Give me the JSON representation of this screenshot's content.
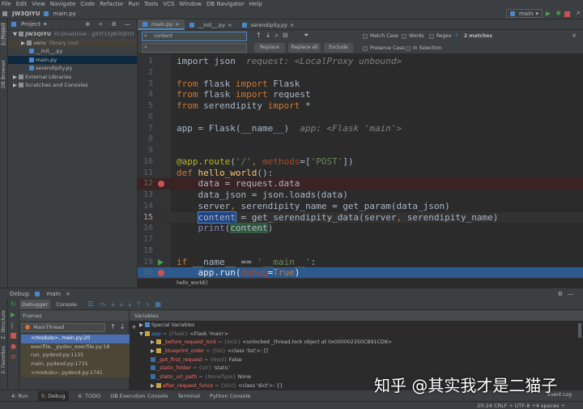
{
  "menu": [
    "File",
    "Edit",
    "View",
    "Navigate",
    "Code",
    "Refactor",
    "Run",
    "Tools",
    "VCS",
    "Window",
    "DB Navigator",
    "Help"
  ],
  "breadcrumb": {
    "project": "JW3QIYU",
    "file": "main.py"
  },
  "run_config": "main",
  "left_strip": {
    "project": "1: Project",
    "db": "DB Browser",
    "structure": "Z: Structure",
    "favorites": "2: Favorites"
  },
  "project_panel": {
    "title": "Project",
    "tree": [
      {
        "label": "JW3QIYU",
        "extra": "H:\\OneDrive - JJXY(1)\\JW3QIYU",
        "level": 0,
        "type": "folder"
      },
      {
        "label": "venv",
        "extra": "library root",
        "level": 1,
        "type": "folder"
      },
      {
        "label": "__init__.py",
        "extra": "",
        "level": 2,
        "type": "py"
      },
      {
        "label": "main.py",
        "extra": "",
        "level": 2,
        "type": "py"
      },
      {
        "label": "serendipity.py",
        "extra": "",
        "level": 2,
        "type": "py"
      },
      {
        "label": "External Libraries",
        "extra": "",
        "level": 0,
        "type": "folder"
      },
      {
        "label": "Scratches and Consoles",
        "extra": "",
        "level": 0,
        "type": "folder"
      }
    ]
  },
  "editor_tabs": [
    {
      "label": "main.py",
      "active": true
    },
    {
      "label": "__init__.py",
      "active": false
    },
    {
      "label": "serendipity.py",
      "active": false
    }
  ],
  "search": {
    "find_value": "content",
    "replace_value": "",
    "replace_label": "Replace",
    "replace_all_label": "Replace all",
    "exclude_label": "Exclude",
    "match_case": "Match Case",
    "words": "Words",
    "regex": "Regex",
    "regex_help": "?",
    "matches": "2 matches",
    "preserve_case": "Preserve Case",
    "in_selection": "In Selection"
  },
  "code_lines": [
    {
      "n": "1",
      "tokens": [
        [
          "import json",
          "t"
        ],
        [
          "  request: <LocalProxy unbound>",
          "c"
        ]
      ]
    },
    {
      "n": "2",
      "tokens": []
    },
    {
      "n": "3",
      "tokens": [
        [
          "from ",
          "k"
        ],
        [
          "flask ",
          "t"
        ],
        [
          "import ",
          "k"
        ],
        [
          "Flask",
          "t"
        ]
      ]
    },
    {
      "n": "4",
      "tokens": [
        [
          "from ",
          "k"
        ],
        [
          "flask ",
          "t"
        ],
        [
          "import ",
          "k"
        ],
        [
          "request",
          "t"
        ]
      ]
    },
    {
      "n": "5",
      "tokens": [
        [
          "from ",
          "k"
        ],
        [
          "serendipity ",
          "t"
        ],
        [
          "import ",
          "k"
        ],
        [
          "*",
          "t"
        ]
      ]
    },
    {
      "n": "6",
      "tokens": []
    },
    {
      "n": "7",
      "tokens": [
        [
          "app = Flask(__name__)",
          "t"
        ],
        [
          "  app: <Flask 'main'>",
          "c"
        ]
      ]
    },
    {
      "n": "8",
      "tokens": []
    },
    {
      "n": "9",
      "tokens": []
    },
    {
      "n": "10",
      "tokens": [
        [
          "@app.route",
          "d"
        ],
        [
          "(",
          "t"
        ],
        [
          "'/'",
          "s"
        ],
        [
          ", ",
          "k"
        ],
        [
          "methods",
          "p"
        ],
        [
          "=[",
          "t"
        ],
        [
          "'POST'",
          "s"
        ],
        [
          "])",
          "t"
        ]
      ]
    },
    {
      "n": "11",
      "tokens": [
        [
          "def ",
          "k"
        ],
        [
          "hello_world",
          "f"
        ],
        [
          "():",
          "t"
        ]
      ]
    },
    {
      "n": "12",
      "tokens": [
        [
          "    data = request.data",
          "t"
        ]
      ],
      "bp": true
    },
    {
      "n": "13",
      "tokens": [
        [
          "    data_json = json.loads(data)",
          "t"
        ]
      ]
    },
    {
      "n": "14",
      "tokens": [
        [
          "    server",
          "t"
        ],
        [
          ", ",
          "k"
        ],
        [
          "serendipity_name = get_param(data_json)",
          "t"
        ]
      ]
    },
    {
      "n": "15",
      "tokens": [
        [
          "    ",
          "t"
        ],
        [
          "content",
          "hl1"
        ],
        [
          " = get_serendipity_data(server",
          "t"
        ],
        [
          ", ",
          "k"
        ],
        [
          "serendipity_name)",
          "t"
        ]
      ]
    },
    {
      "n": "16",
      "tokens": [
        [
          "    ",
          "t"
        ],
        [
          "print",
          "b"
        ],
        [
          "(",
          "t"
        ],
        [
          "content",
          "hl2"
        ],
        [
          ")",
          "t"
        ]
      ]
    },
    {
      "n": "17",
      "tokens": []
    },
    {
      "n": "18",
      "tokens": []
    },
    {
      "n": "19",
      "tokens": [
        [
          "if ",
          "k"
        ],
        [
          "__name__ == ",
          "t"
        ],
        [
          "'__main__'",
          "s"
        ],
        [
          ":",
          "t"
        ]
      ],
      "run": true
    },
    {
      "n": "20",
      "tokens": [
        [
          "    app.run(",
          "t"
        ],
        [
          "debug",
          "p"
        ],
        [
          "=",
          "t"
        ],
        [
          "True",
          "k"
        ],
        [
          ")",
          "t"
        ]
      ],
      "bp": true,
      "exec": true
    }
  ],
  "editor_breadcrumb": "hello_world()",
  "debug": {
    "label": "Debug:",
    "session": "main",
    "tabs": [
      "Debugger",
      "Console"
    ],
    "frames_title": "Frames",
    "thread": "MainThread",
    "frames": [
      "<module>, main.py:20",
      "execfile, _pydev_execfile.py:18",
      "run, pydevd.py:1135",
      "main, pydevd.py:1735",
      "<module>, pydevd.py:1741"
    ],
    "variables_title": "Variables",
    "variables": [
      {
        "indent": 0,
        "arrow": "▶",
        "name": "Special Variables",
        "type": "",
        "value": "",
        "special": true
      },
      {
        "indent": 0,
        "arrow": "▼",
        "name": "app",
        "type": "{Flask}",
        "value": "<Flask 'main'>"
      },
      {
        "indent": 1,
        "arrow": "▶",
        "name": "_before_request_lock",
        "type": "{lock}",
        "value": "<unlocked _thread.lock object at 0x000002350CB91CD8>"
      },
      {
        "indent": 1,
        "arrow": "▶",
        "name": "_blueprint_order",
        "type": "{list}",
        "value": "<class 'list'>: []"
      },
      {
        "indent": 1,
        "arrow": "",
        "name": "_got_first_request",
        "type": "{bool}",
        "value": "False"
      },
      {
        "indent": 1,
        "arrow": "",
        "name": "_static_folder",
        "type": "{str}",
        "value": "'static'"
      },
      {
        "indent": 1,
        "arrow": "",
        "name": "_static_url_path",
        "type": "{NoneType}",
        "value": "None"
      },
      {
        "indent": 1,
        "arrow": "▶",
        "name": "after_request_funcs",
        "type": "{dict}",
        "value": "<class 'dict'>: {}"
      }
    ]
  },
  "bottom_tools": [
    "4: Run",
    "5: Debug",
    "6: TODO",
    "DB Execution Console",
    "Terminal",
    "Python Console"
  ],
  "event_log": "Event Log",
  "status": {
    "position": "20:24",
    "line_sep": "CRLF ÷",
    "encoding": "UTF-8 ÷",
    "indent": "4 spaces ÷"
  },
  "watermark": "知乎 @其实我才是二猫子",
  "colors": {
    "keyword": "#cc7832",
    "string": "#6a8759",
    "selection": "#2d5a8e",
    "breakpoint": "#c75450"
  }
}
